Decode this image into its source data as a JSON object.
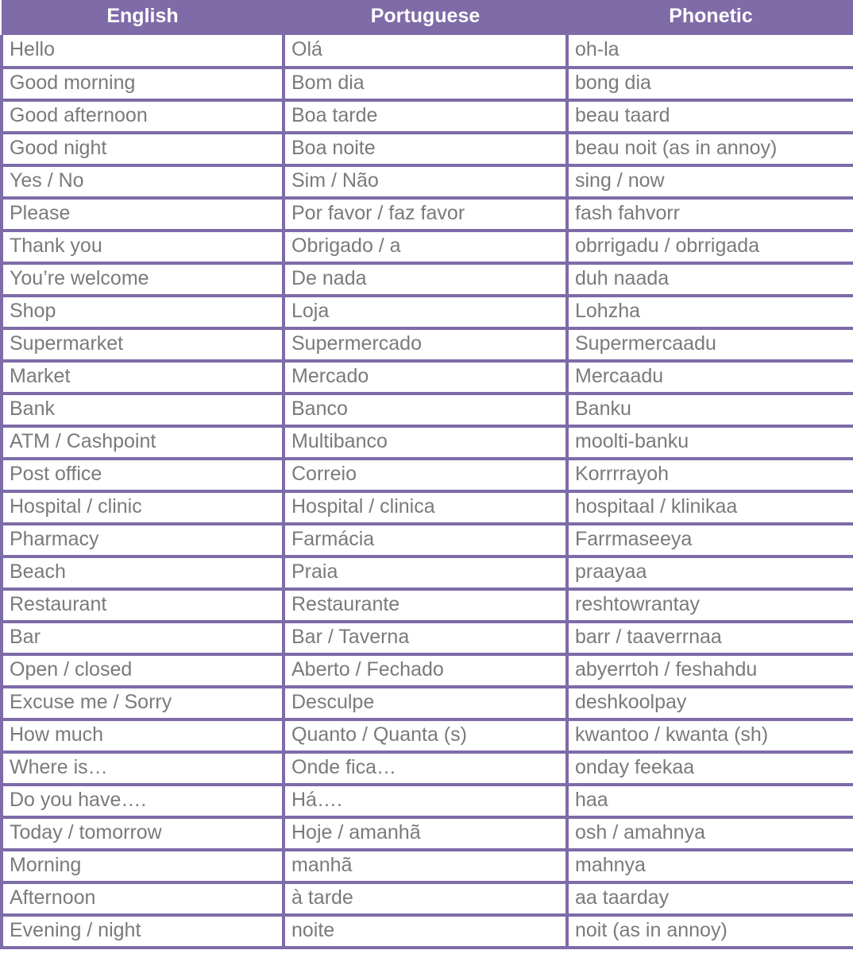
{
  "table": {
    "columns": [
      {
        "key": "english",
        "label": "English"
      },
      {
        "key": "portuguese",
        "label": "Portuguese"
      },
      {
        "key": "phonetic",
        "label": "Phonetic"
      }
    ],
    "colors": {
      "header_background": "#7E6BA8",
      "header_text": "#FFFFFF",
      "border": "#7E6BA8",
      "cell_background": "#FFFFFF",
      "cell_text": "#7A7A7A"
    },
    "rows": [
      {
        "english": "Hello",
        "portuguese": "Olá",
        "phonetic": "oh-la"
      },
      {
        "english": "Good morning",
        "portuguese": "Bom dia",
        "phonetic": "bong dia"
      },
      {
        "english": "Good afternoon",
        "portuguese": "Boa tarde",
        "phonetic": "beau taard"
      },
      {
        "english": "Good night",
        "portuguese": "Boa noite",
        "phonetic": "beau noit (as in annoy)"
      },
      {
        "english": "Yes / No",
        "portuguese": "Sim / Não",
        "phonetic": "sing / now"
      },
      {
        "english": "Please",
        "portuguese": "Por favor / faz favor",
        "phonetic": "fash fahvorr"
      },
      {
        "english": "Thank you",
        "portuguese": "Obrigado / a",
        "phonetic": "obrrigadu / obrrigada"
      },
      {
        "english": "You’re welcome",
        "portuguese": "De nada",
        "phonetic": "duh naada"
      },
      {
        "english": "Shop",
        "portuguese": "Loja",
        "phonetic": "Lohzha"
      },
      {
        "english": "Supermarket",
        "portuguese": "Supermercado",
        "phonetic": "Supermercaadu"
      },
      {
        "english": "Market",
        "portuguese": "Mercado",
        "phonetic": "Mercaadu"
      },
      {
        "english": "Bank",
        "portuguese": "Banco",
        "phonetic": "Banku"
      },
      {
        "english": "ATM / Cashpoint",
        "portuguese": "Multibanco",
        "phonetic": "moolti-banku"
      },
      {
        "english": "Post office",
        "portuguese": "Correio",
        "phonetic": "Korrrrayoh"
      },
      {
        "english": "Hospital / clinic",
        "portuguese": "Hospital / clinica",
        "phonetic": "hospitaal / klinikaa"
      },
      {
        "english": "Pharmacy",
        "portuguese": "Farmácia",
        "phonetic": "Farrmaseeya"
      },
      {
        "english": "Beach",
        "portuguese": "Praia",
        "phonetic": "praayaa"
      },
      {
        "english": "Restaurant",
        "portuguese": "Restaurante",
        "phonetic": "reshtowrantay"
      },
      {
        "english": "Bar",
        "portuguese": "Bar / Taverna",
        "phonetic": "barr / taaverrnaa"
      },
      {
        "english": "Open / closed",
        "portuguese": "Aberto / Fechado",
        "phonetic": "abyerrtoh / feshahdu"
      },
      {
        "english": "Excuse me / Sorry",
        "portuguese": "Desculpe",
        "phonetic": "deshkoolpay"
      },
      {
        "english": "How much",
        "portuguese": "Quanto / Quanta (s)",
        "phonetic": "kwantoo / kwanta (sh)"
      },
      {
        "english": "Where is…",
        "portuguese": "Onde fica…",
        "phonetic": "onday feekaa"
      },
      {
        "english": "Do you have….",
        "portuguese": "Há….",
        "phonetic": "haa"
      },
      {
        "english": "Today / tomorrow",
        "portuguese": "Hoje / amanhã",
        "phonetic": "osh / amahnya"
      },
      {
        "english": "Morning",
        "portuguese": "manhã",
        "phonetic": "mahnya"
      },
      {
        "english": "Afternoon",
        "portuguese": "à tarde",
        "phonetic": "aa taarday"
      },
      {
        "english": "Evening / night",
        "portuguese": "noite",
        "phonetic": "noit (as in annoy)"
      }
    ]
  }
}
